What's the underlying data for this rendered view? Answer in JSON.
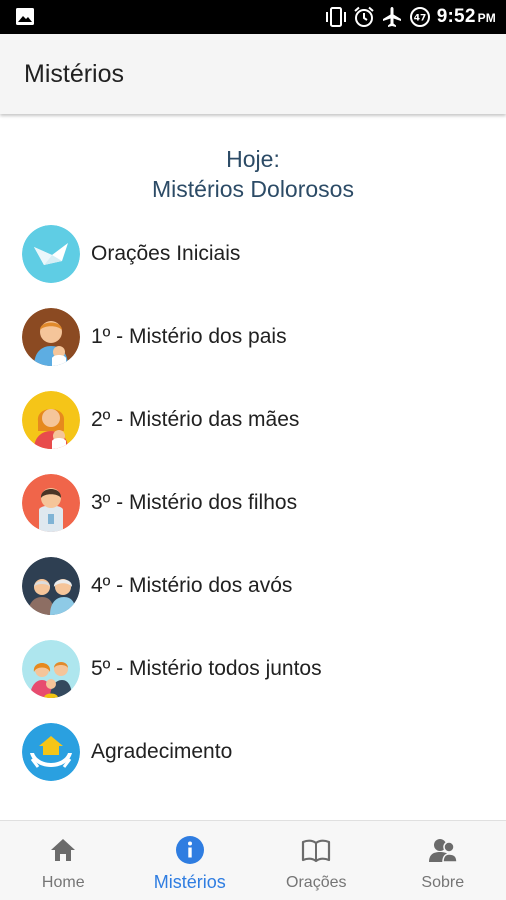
{
  "status_bar": {
    "time": "9:52",
    "ampm": "PM",
    "battery_level": "47",
    "icons": [
      "image-icon",
      "vibrate-icon",
      "alarm-icon",
      "airplane-icon",
      "battery-saver-icon"
    ]
  },
  "app_bar": {
    "title": "Mistérios"
  },
  "today": {
    "line1": "Hoje:",
    "line2": "Mistérios Dolorosos"
  },
  "list": {
    "items": [
      {
        "label": "Orações Iniciais",
        "icon": "dove-icon"
      },
      {
        "label": "1º - Mistério dos pais",
        "icon": "father-icon"
      },
      {
        "label": "2º - Mistério das mães",
        "icon": "mother-icon"
      },
      {
        "label": "3º - Mistério dos filhos",
        "icon": "child-icon"
      },
      {
        "label": "4º - Mistério dos avós",
        "icon": "grandparents-icon"
      },
      {
        "label": "5º - Mistério todos juntos",
        "icon": "family-icon"
      },
      {
        "label": "Agradecimento",
        "icon": "hands-house-icon"
      }
    ]
  },
  "bottom_nav": {
    "items": [
      {
        "label": "Home",
        "icon": "home-icon",
        "active": false
      },
      {
        "label": "Mistérios",
        "icon": "info-icon",
        "active": true
      },
      {
        "label": "Orações",
        "icon": "book-icon",
        "active": false
      },
      {
        "label": "Sobre",
        "icon": "people-icon",
        "active": false
      }
    ]
  },
  "colors": {
    "accent": "#2f7de1",
    "heading": "#2c4b66",
    "app_bar": "#f5f5f5"
  }
}
